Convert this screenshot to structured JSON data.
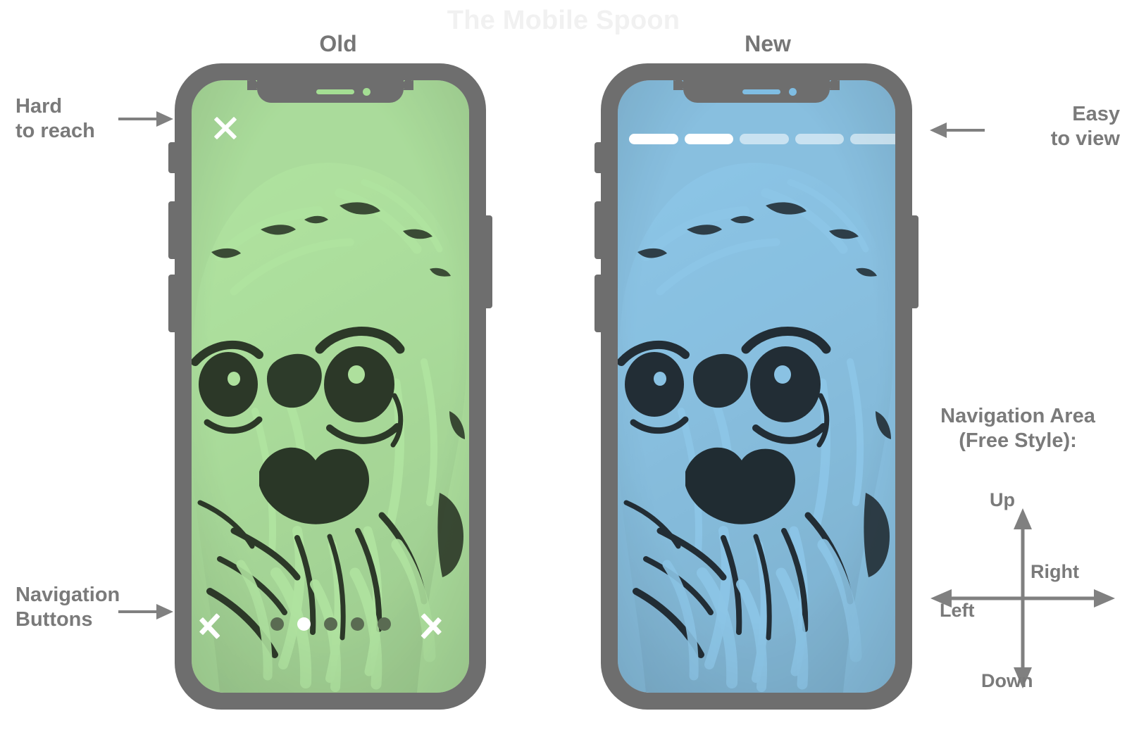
{
  "watermark": "The Mobile Spoon",
  "captions": {
    "old": "Old",
    "new": "New"
  },
  "annotations": {
    "hard_to_reach_line1": "Hard",
    "hard_to_reach_line2": "to reach",
    "navigation_buttons_line1": "Navigation",
    "navigation_buttons_line2": "Buttons",
    "easy_to_view_line1": "Easy",
    "easy_to_view_line2": "to view",
    "navigation_area_line1": "Navigation Area",
    "navigation_area_line2": "(Free Style):"
  },
  "directions": {
    "up": "Up",
    "down": "Down",
    "left": "Left",
    "right": "Right"
  },
  "old_phone": {
    "screen_tint": "#a4de93",
    "close_icon": "close-x-icon",
    "prev_icon": "chevron-left-icon",
    "next_icon": "chevron-right-icon",
    "dots_total": 5,
    "dots_active_index": 1,
    "dot_inactive_color": "#5a6b52",
    "dot_active_color": "#ffffff"
  },
  "new_phone": {
    "screen_tint": "#7fbde3",
    "story_bars_total": 5,
    "story_bars_filled": 2,
    "story_filled_color": "#ffffff",
    "story_empty_color": "rgba(255,255,255,0.55)"
  },
  "colors": {
    "phone_body": "#6e6e6e",
    "text_gray": "#7a7a7a",
    "caption_gray": "#767676",
    "arrow_gray": "#808080",
    "watermark_gray": "#f1f1f1",
    "background": "#ffffff"
  },
  "artwork": {
    "subject": "dog-portrait-image"
  }
}
